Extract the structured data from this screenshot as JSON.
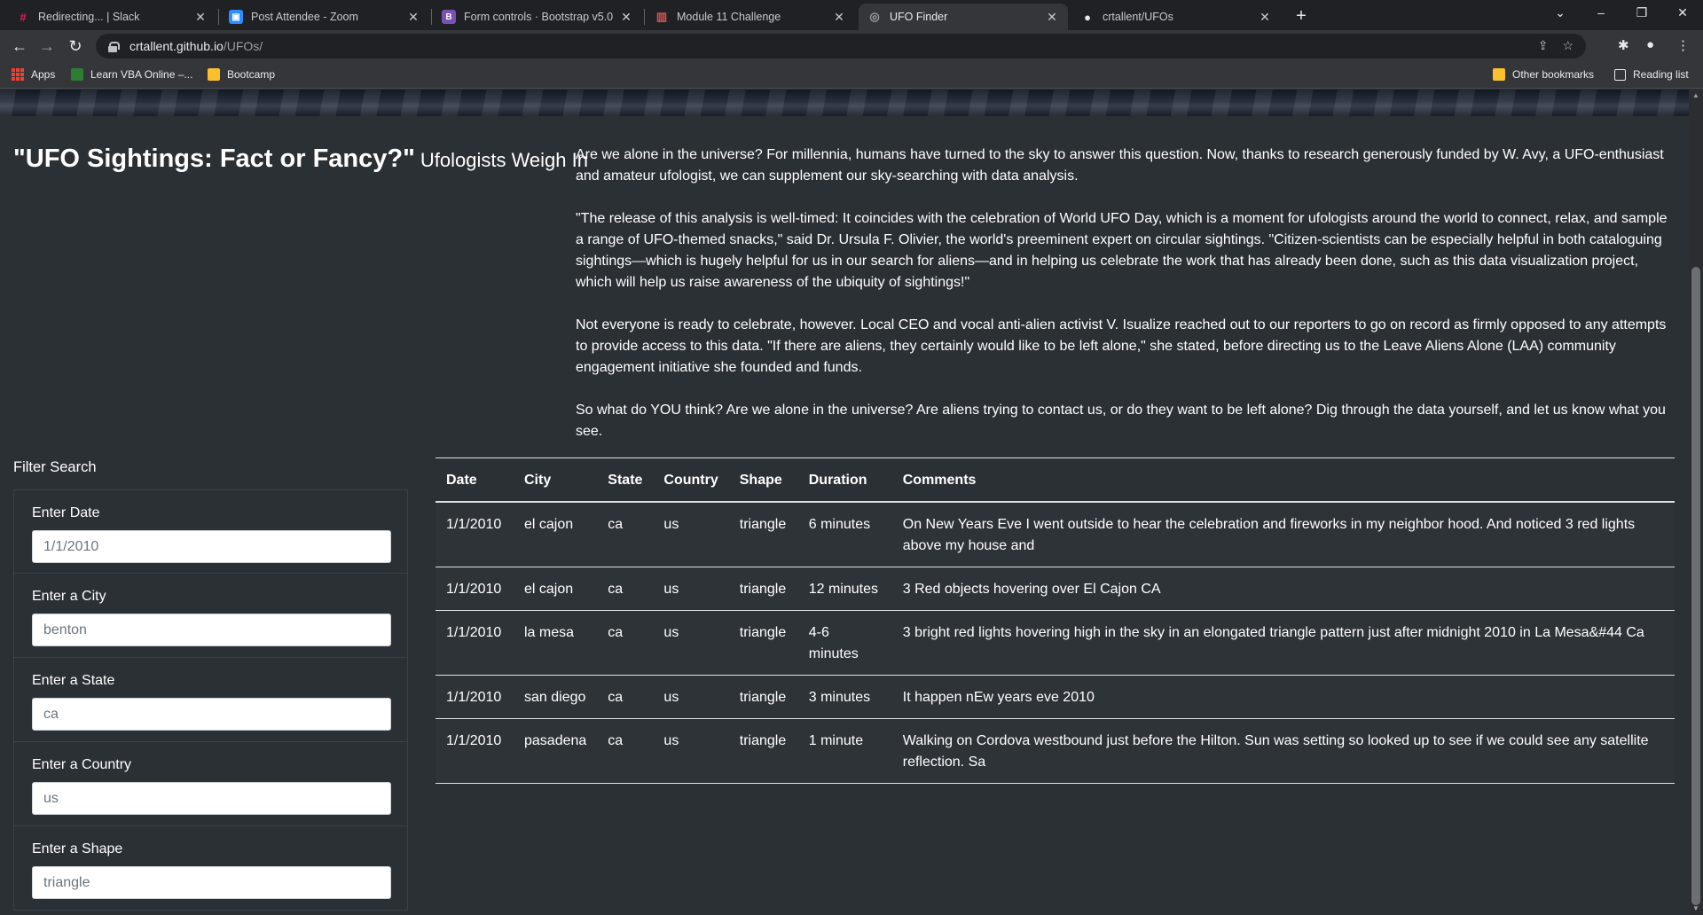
{
  "browser": {
    "tabs": [
      {
        "title": "Redirecting... | Slack",
        "icon": "slack-icon",
        "color": "#e01e5a"
      },
      {
        "title": "Post Attendee - Zoom",
        "icon": "zoom-icon",
        "color": "#2d8cff"
      },
      {
        "title": "Form controls · Bootstrap v5.0",
        "icon": "bootstrap-icon",
        "color": "#7952b3"
      },
      {
        "title": "Module 11 Challenge",
        "icon": "module-icon",
        "color": "#d9534f"
      },
      {
        "title": "UFO Finder",
        "icon": "globe-icon",
        "color": "#9aa0a6"
      },
      {
        "title": "crtallent/UFOs",
        "icon": "github-icon",
        "color": "#e8eaed"
      }
    ],
    "active_tab": 4,
    "url_host": "crtallent.github.io",
    "url_path": "/UFOs/",
    "bookmarks": {
      "apps": "Apps",
      "learn_vba": "Learn VBA Online –...",
      "bootcamp": "Bootcamp",
      "other": "Other bookmarks",
      "reading_list": "Reading list"
    }
  },
  "page": {
    "headline": "\"UFO Sightings: Fact or Fancy?\"",
    "subheadline": "Ufologists Weigh In",
    "paragraphs": [
      "Are we alone in the universe? For millennia, humans have turned to the sky to answer this question. Now, thanks to research generously funded by W. Avy, a UFO-enthusiast and amateur ufologist, we can supplement our sky-searching with data analysis.",
      "\"The release of this analysis is well-timed: It coincides with the celebration of World UFO Day, which is a moment for ufologists around the world to connect, relax, and sample a range of UFO-themed snacks,\" said Dr. Ursula F. Olivier, the world's preeminent expert on circular sightings. \"Citizen-scientists can be especially helpful in both cataloguing sightings—which is hugely helpful for us in our search for aliens—and in helping us celebrate the work that has already been done, such as this data visualization project, which will help us raise awareness of the ubiquity of sightings!\"",
      "Not everyone is ready to celebrate, however. Local CEO and vocal anti-alien activist V. Isualize reached out to our reporters to go on record as firmly opposed to any attempts to provide access to this data. \"If there are aliens, they certainly would like to be left alone,\" she stated, before directing us to the Leave Aliens Alone (LAA) community engagement initiative she founded and funds.",
      "So what do YOU think? Are we alone in the universe? Are aliens trying to contact us, or do they want to be left alone? Dig through the data yourself, and let us know what you see."
    ],
    "filter_title": "Filter Search",
    "filters": [
      {
        "label": "Enter Date",
        "placeholder": "1/1/2010"
      },
      {
        "label": "Enter a City",
        "placeholder": "benton"
      },
      {
        "label": "Enter a State",
        "placeholder": "ca"
      },
      {
        "label": "Enter a Country",
        "placeholder": "us"
      },
      {
        "label": "Enter a Shape",
        "placeholder": "triangle"
      }
    ],
    "table": {
      "headers": [
        "Date",
        "City",
        "State",
        "Country",
        "Shape",
        "Duration",
        "Comments"
      ],
      "rows": [
        [
          "1/1/2010",
          "el cajon",
          "ca",
          "us",
          "triangle",
          "6 minutes",
          "On New Years Eve I went outside to hear the celebration and fireworks in my neighbor hood. And noticed 3 red lights above my house and"
        ],
        [
          "1/1/2010",
          "el cajon",
          "ca",
          "us",
          "triangle",
          "12 minutes",
          "3 Red objects hovering over El Cajon CA"
        ],
        [
          "1/1/2010",
          "la mesa",
          "ca",
          "us",
          "triangle",
          "4-6 minutes",
          "3 bright red lights hovering high in the sky in an elongated triangle pattern just after midnight 2010 in La Mesa&#44 Ca"
        ],
        [
          "1/1/2010",
          "san diego",
          "ca",
          "us",
          "triangle",
          "3 minutes",
          "It happen nEw years eve 2010"
        ],
        [
          "1/1/2010",
          "pasadena",
          "ca",
          "us",
          "triangle",
          "1 minute",
          "Walking on Cordova westbound just before the Hilton. Sun was setting so looked up to see if we could see any satellite reflection. Sa"
        ]
      ]
    }
  }
}
